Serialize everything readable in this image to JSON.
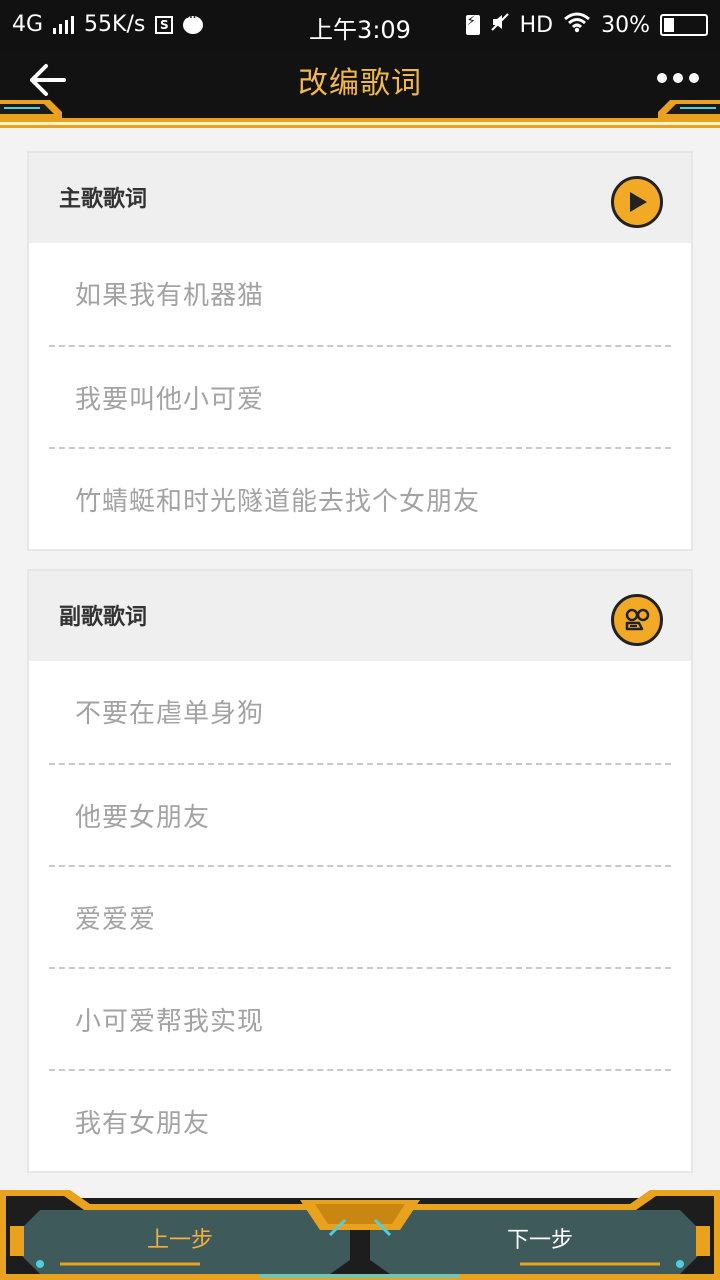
{
  "status_bar": {
    "network": "4G",
    "speed": "55K/s",
    "s_badge": "S",
    "time": "上午3:09",
    "hd": "HD",
    "battery": "30%"
  },
  "header": {
    "title": "改编歌词",
    "back_icon": "arrow-left-icon",
    "more_icon": "more-dots-icon"
  },
  "sections": [
    {
      "title": "主歌歌词",
      "icon": "play-icon",
      "lines": [
        "如果我有机器猫",
        "我要叫他小可爱",
        "竹蜻蜓和时光隧道能去找个女朋友"
      ]
    },
    {
      "title": "副歌歌词",
      "icon": "voice-record-icon",
      "lines": [
        "不要在虐单身狗",
        "他要女朋友",
        "爱爱爱",
        "小可爱帮我实现",
        "我有女朋友"
      ]
    }
  ],
  "footer": {
    "prev_label": "上一步",
    "next_label": "下一步"
  },
  "colors": {
    "accent": "#f2b84b",
    "header_bg": "#121212",
    "footer_panel": "#3f5a5a",
    "lyric_text": "#a3a3a3"
  }
}
